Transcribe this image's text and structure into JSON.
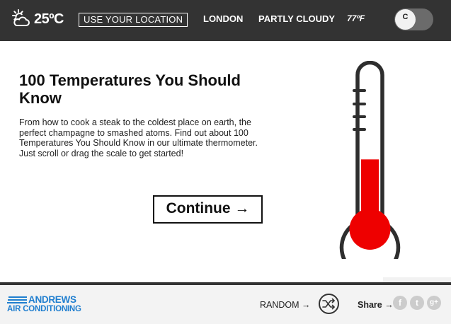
{
  "topbar": {
    "weather_icon": "partly-cloudy-sun-icon",
    "temperature_c": "25ºC",
    "use_location": "USE YOUR LOCATION",
    "city": "LONDON",
    "condition": "PARTLY CLOUDY",
    "temperature_f": "77ºF",
    "unit_toggle": "C"
  },
  "main": {
    "headline": "100 Temperatures You Should Know",
    "intro": "From how to cook a steak to the coldest place on earth, the perfect champagne to smashed atoms. Find out about 100 Temperatures You Should Know in our ultimate thermometer. Just scroll or drag the scale to get started!",
    "continue_label": "Continue →",
    "thermometer_icon": "thermometer-icon",
    "thermometer_fill": 0.46
  },
  "footer": {
    "logo_line1": "ANDREWS",
    "logo_line2": "AIR CONDITIONING",
    "random_label": "RANDOM →",
    "shuffle_icon": "shuffle-icon",
    "share_label": "Share →",
    "social_icons": [
      "facebook-icon",
      "twitter-icon",
      "google-plus-icon"
    ],
    "social_glyphs": [
      "f",
      "t",
      "g+"
    ]
  },
  "colors": {
    "topbar_bg": "#333333",
    "mercury": "#ee0000",
    "brand_blue": "#1f7ecf",
    "social_grey": "#cccccc"
  }
}
